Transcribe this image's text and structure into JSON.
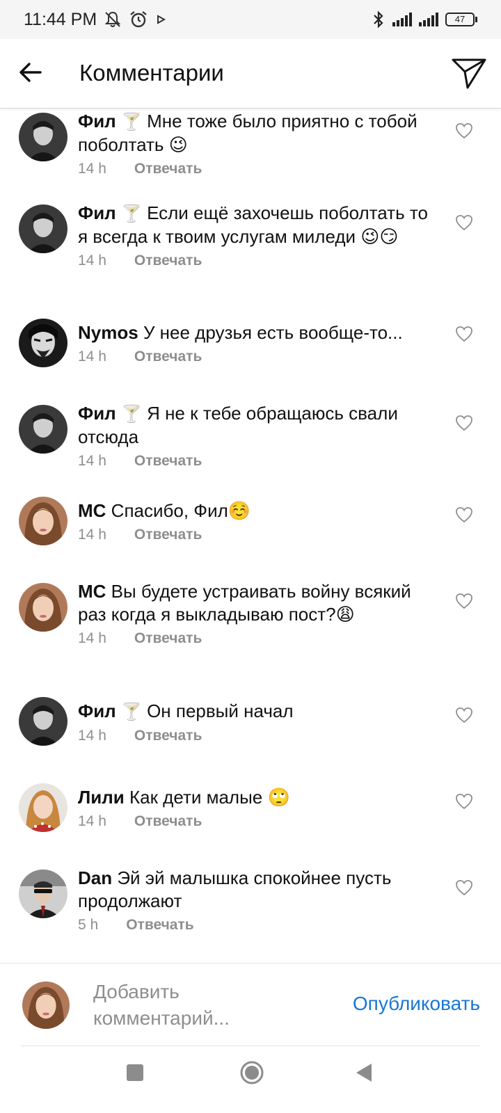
{
  "status_bar": {
    "time": "11:44 PM",
    "battery": "47",
    "icons": [
      "mute-icon",
      "alarm-icon",
      "play-icon",
      "bluetooth-icon",
      "signal-icon",
      "battery-icon"
    ]
  },
  "header": {
    "title": "Комментарии"
  },
  "comments": [
    {
      "username": "Фил",
      "badge": "🍸",
      "text": "Мне тоже было приятно с тобой поболтать 😉",
      "time": "14 h",
      "reply": "Отвечать",
      "avatar": "fil"
    },
    {
      "username": "Фил",
      "badge": "🍸",
      "text": "Если ещё захочешь поболтать то я всегда к твоим услугам миледи 😉😏",
      "time": "14 h",
      "reply": "Отвечать",
      "avatar": "fil"
    },
    {
      "username": "Nymos",
      "badge": "",
      "text": "У нее друзья есть вообще-то...",
      "time": "14 h",
      "reply": "Отвечать",
      "avatar": "nymos"
    },
    {
      "username": "Фил",
      "badge": "🍸",
      "text": "Я не к тебе обращаюсь свали отсюда",
      "time": "14 h",
      "reply": "Отвечать",
      "avatar": "fil"
    },
    {
      "username": "MC",
      "badge": "",
      "text": "Спасибо, Фил☺️",
      "time": "14 h",
      "reply": "Отвечать",
      "avatar": "mc"
    },
    {
      "username": "MC",
      "badge": "",
      "text": "Вы будете устраивать войну всякий раз когда я выкладываю пост?😩",
      "time": "14 h",
      "reply": "Отвечать",
      "avatar": "mc"
    },
    {
      "username": "Фил",
      "badge": "🍸",
      "text": "Он первый начал",
      "time": "14 h",
      "reply": "Отвечать",
      "avatar": "fil"
    },
    {
      "username": "Лили",
      "badge": "",
      "text": "Как дети малые 🙄",
      "time": "14 h",
      "reply": "Отвечать",
      "avatar": "lili"
    },
    {
      "username": "Dan",
      "badge": "",
      "text": "Эй эй малышка спокойнее пусть продолжают",
      "time": "5 h",
      "reply": "Отвечать",
      "avatar": "dan"
    }
  ],
  "composer": {
    "placeholder": "Добавить комментарий...",
    "publish_label": "Опубликовать"
  },
  "colors": {
    "accent": "#1877d4",
    "secondary_text": "#8e8e8e",
    "primary_text": "#111111"
  }
}
